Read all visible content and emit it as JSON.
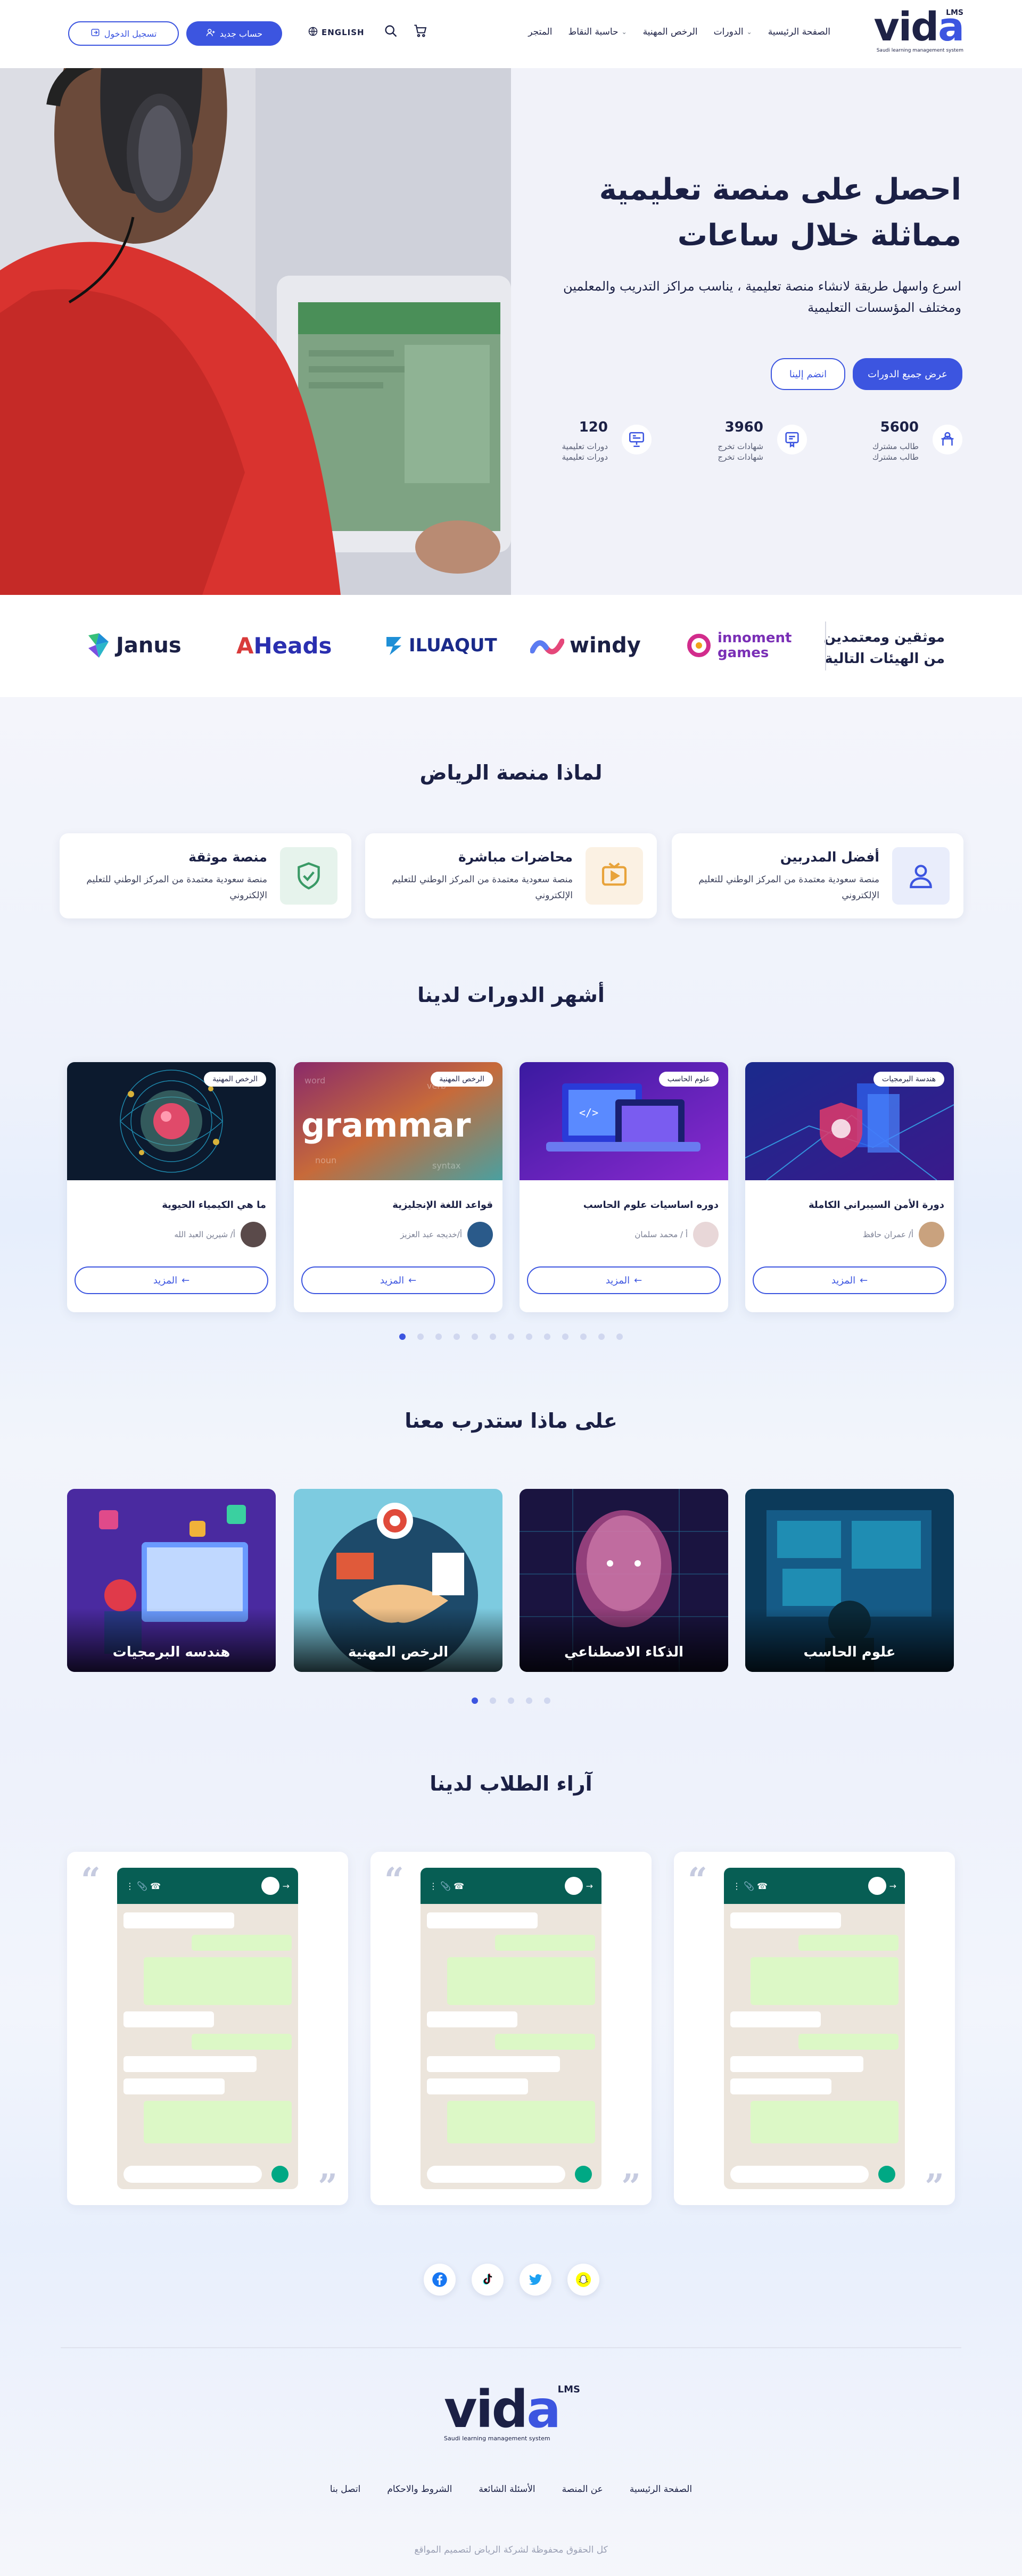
{
  "header": {
    "logo": {
      "word_start": "vid",
      "word_end": "a",
      "badge": "LMS",
      "tagline": "Saudi learning management system"
    },
    "nav": [
      {
        "label": "الصفحة الرئيسية",
        "has_dropdown": false
      },
      {
        "label": "الدورات",
        "has_dropdown": true
      },
      {
        "label": "الرخص المهنية",
        "has_dropdown": false
      },
      {
        "label": "حاسبة النقاط",
        "has_dropdown": true
      },
      {
        "label": "المتجر",
        "has_dropdown": false
      }
    ],
    "language": "ENGLISH",
    "register_button": "حساب جديد",
    "login_button": "تسجيل الدخول"
  },
  "hero": {
    "title": "احصل على منصة تعليمية مماثلة خلال ساعات",
    "description": "اسرع واسهل طريقة لانشاء منصة تعليمية ، يناسب مراكز التدريب والمعلمين ومختلف المؤسسات التعليمية",
    "primary_button": "عرض جميع الدورات",
    "secondary_button": "انضم إلينا",
    "stats": [
      {
        "value": "5600",
        "line1": "طالب مشترك",
        "line2": "طالب مشترك",
        "icon": "student-icon"
      },
      {
        "value": "3960",
        "line1": "شهادات تخرج",
        "line2": "شهادات تخرج",
        "icon": "certificate-icon"
      },
      {
        "value": "120",
        "line1": "دورات تعليمية",
        "line2": "دورات تعليمية",
        "icon": "courses-icon"
      }
    ]
  },
  "partners": {
    "label": "موثقين ومعتمدين من الهيئات التالية",
    "logos": [
      {
        "name": "innoment",
        "name2": "games",
        "color": "#7a2fb6"
      },
      {
        "name": "windy",
        "color": "#1b2045"
      },
      {
        "name": "ILUAQUT",
        "color": "#1a2a8a"
      },
      {
        "name": "Heads",
        "prefix": "A",
        "color": "#2a2fb0"
      },
      {
        "name": "Janus",
        "color": "#1b2045"
      }
    ]
  },
  "why": {
    "title": "لماذا منصة الرياض",
    "features": [
      {
        "title": "أفضل المدربين",
        "text": "منصة سعودية معتمدة من المركز الوطني للتعليم الإلكتروني",
        "icon": "trainer-icon",
        "bg": "#e9edfb",
        "color": "#3c55e0"
      },
      {
        "title": "محاضرات مباشرة",
        "text": "منصة سعودية معتمدة من المركز الوطني للتعليم الإلكتروني",
        "icon": "live-lecture-icon",
        "bg": "#fbf1e3",
        "color": "#e8a33a"
      },
      {
        "title": "منصة موثقة",
        "text": "منصة سعودية معتمدة من المركز الوطني للتعليم الإلكتروني",
        "icon": "verified-shield-icon",
        "bg": "#e6f3ec",
        "color": "#3a9a66"
      }
    ]
  },
  "courses": {
    "title": "أشهر الدورات لدينا",
    "more_label": "المزيد",
    "items": [
      {
        "title": "دورة الأمن السيبراني الكاملة",
        "tag": "هندسة البرمجيات",
        "author": "أ/ عمران حافظ"
      },
      {
        "title": "دوره اساسيات علوم الحاسب",
        "tag": "علوم الحاسب",
        "author": "أ / محمد سلمان"
      },
      {
        "title": "قواعد اللغة الإنجليزية",
        "tag": "الرخص المهنية",
        "author": "أ/خديجه عبد العزيز"
      },
      {
        "title": "ما هي الكيمياء الحيوية",
        "tag": "الرخص المهنية",
        "author": "أ/ شيرين العبد الله"
      }
    ],
    "dots_total": 13,
    "dots_active": 0
  },
  "training": {
    "title": "على ماذا ستدرب معنا",
    "items": [
      {
        "label": "علوم الحاسب"
      },
      {
        "label": "الذكاء الاصطناعي"
      },
      {
        "label": "الرخص المهنية"
      },
      {
        "label": "هندسه البرمجيات"
      }
    ],
    "dots_total": 5,
    "dots_active": 0
  },
  "reviews": {
    "title": "آراء الطلاب لدينا",
    "count": 3
  },
  "social": [
    {
      "icon": "snapchat-icon",
      "color": "#fffc00"
    },
    {
      "icon": "twitter-icon",
      "color": "#1da1f2"
    },
    {
      "icon": "tiktok-icon",
      "color": "#111111"
    },
    {
      "icon": "facebook-icon",
      "color": "#1877f2"
    }
  ],
  "footer": {
    "links": [
      "الصفحة الرئيسية",
      "عن المنصة",
      "الأسئلة الشائعة",
      "الشروط والاحكام",
      "اتصل بنا"
    ],
    "copyright": "كل الحقوق محفوظة لشركة الرياض لتصميم المواقع"
  },
  "colors": {
    "primary": "#3c55e0",
    "dark": "#1b2045"
  }
}
